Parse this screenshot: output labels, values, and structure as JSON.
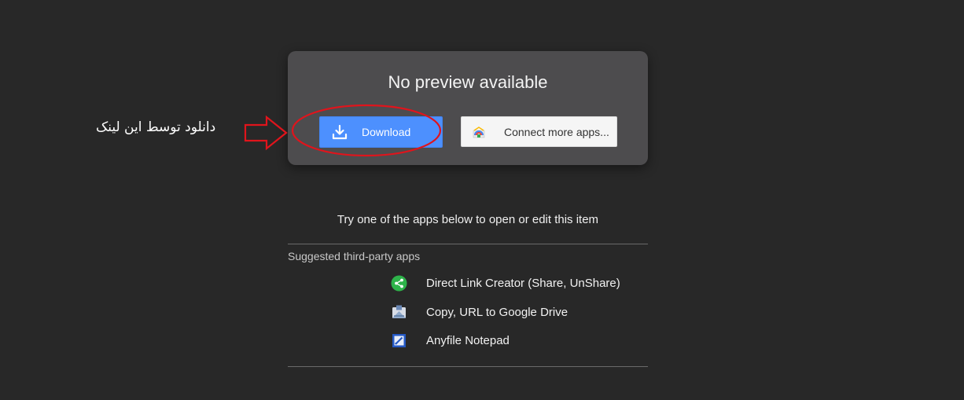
{
  "preview_card": {
    "title": "No preview available",
    "download_label": "Download",
    "connect_label": "Connect more apps..."
  },
  "annotation": {
    "text": "دانلود توسط این لینک",
    "color": "#e0141c"
  },
  "apps_section": {
    "instruction": "Try one of the apps below to open or edit this item",
    "heading": "Suggested third-party apps",
    "apps": [
      {
        "name": "Direct Link Creator (Share, UnShare)",
        "icon": "share-icon"
      },
      {
        "name": "Copy, URL to Google Drive",
        "icon": "drive-copy-icon"
      },
      {
        "name": "Anyfile Notepad",
        "icon": "notepad-icon"
      }
    ]
  },
  "colors": {
    "background": "#282828",
    "card": "#4d4c4e",
    "accent": "#4d90fe"
  }
}
